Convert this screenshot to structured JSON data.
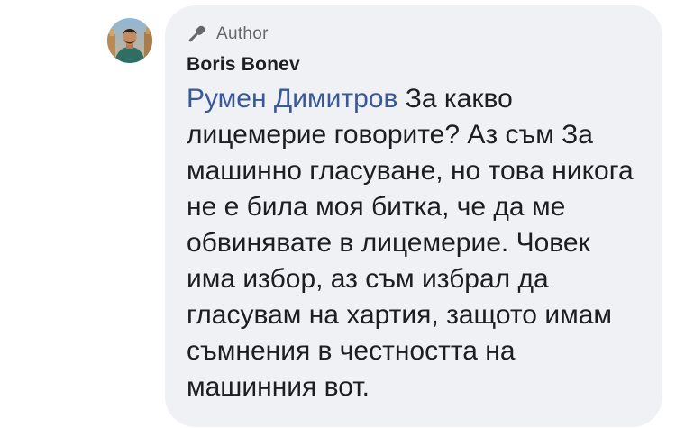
{
  "comment": {
    "badge": {
      "icon": "microphone-icon",
      "label": "Author"
    },
    "commenter_name": "Boris Bonev",
    "mention": "Румен Димитров",
    "text": "За какво лицемерие говорите? Аз съм За машинно гласуване, но това никога не е била моя битка, че да ме обвинявате в лицемерие. Човек има избор, аз съм избрал да гласувам на хартия, защото имам съмнения в честността на машинния вот.",
    "colors": {
      "bubble_background": "#eff1f4",
      "mention": "#385898",
      "text": "#1c1e21",
      "badge_text": "#65676b"
    }
  }
}
